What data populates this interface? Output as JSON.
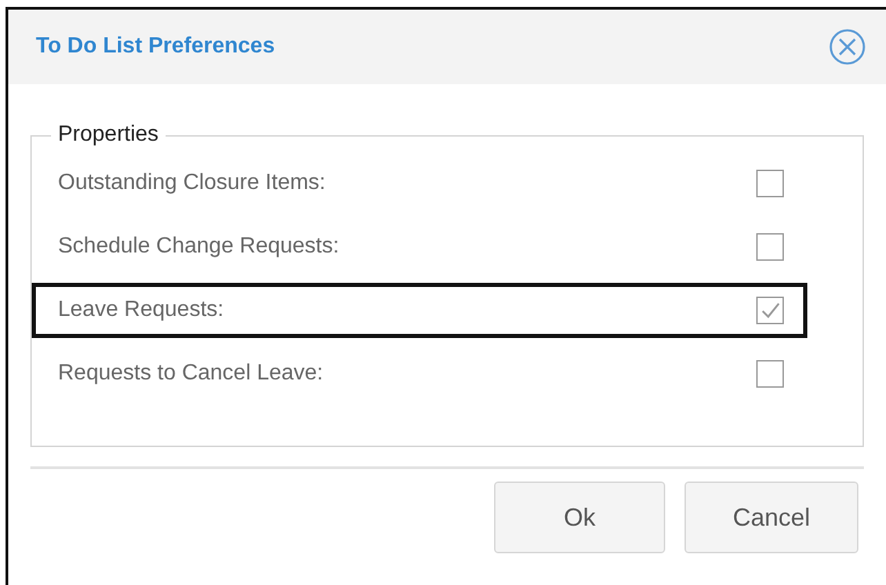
{
  "dialog": {
    "title": "To Do List Preferences"
  },
  "fieldset": {
    "legend": "Properties",
    "items": [
      {
        "label": "Outstanding Closure Items:",
        "checked": false,
        "focused": false
      },
      {
        "label": "Schedule Change Requests:",
        "checked": false,
        "focused": false
      },
      {
        "label": "Leave Requests:",
        "checked": true,
        "focused": true
      },
      {
        "label": "Requests to Cancel Leave:",
        "checked": false,
        "focused": false
      }
    ]
  },
  "buttons": [
    "Ok",
    "Cancel"
  ]
}
